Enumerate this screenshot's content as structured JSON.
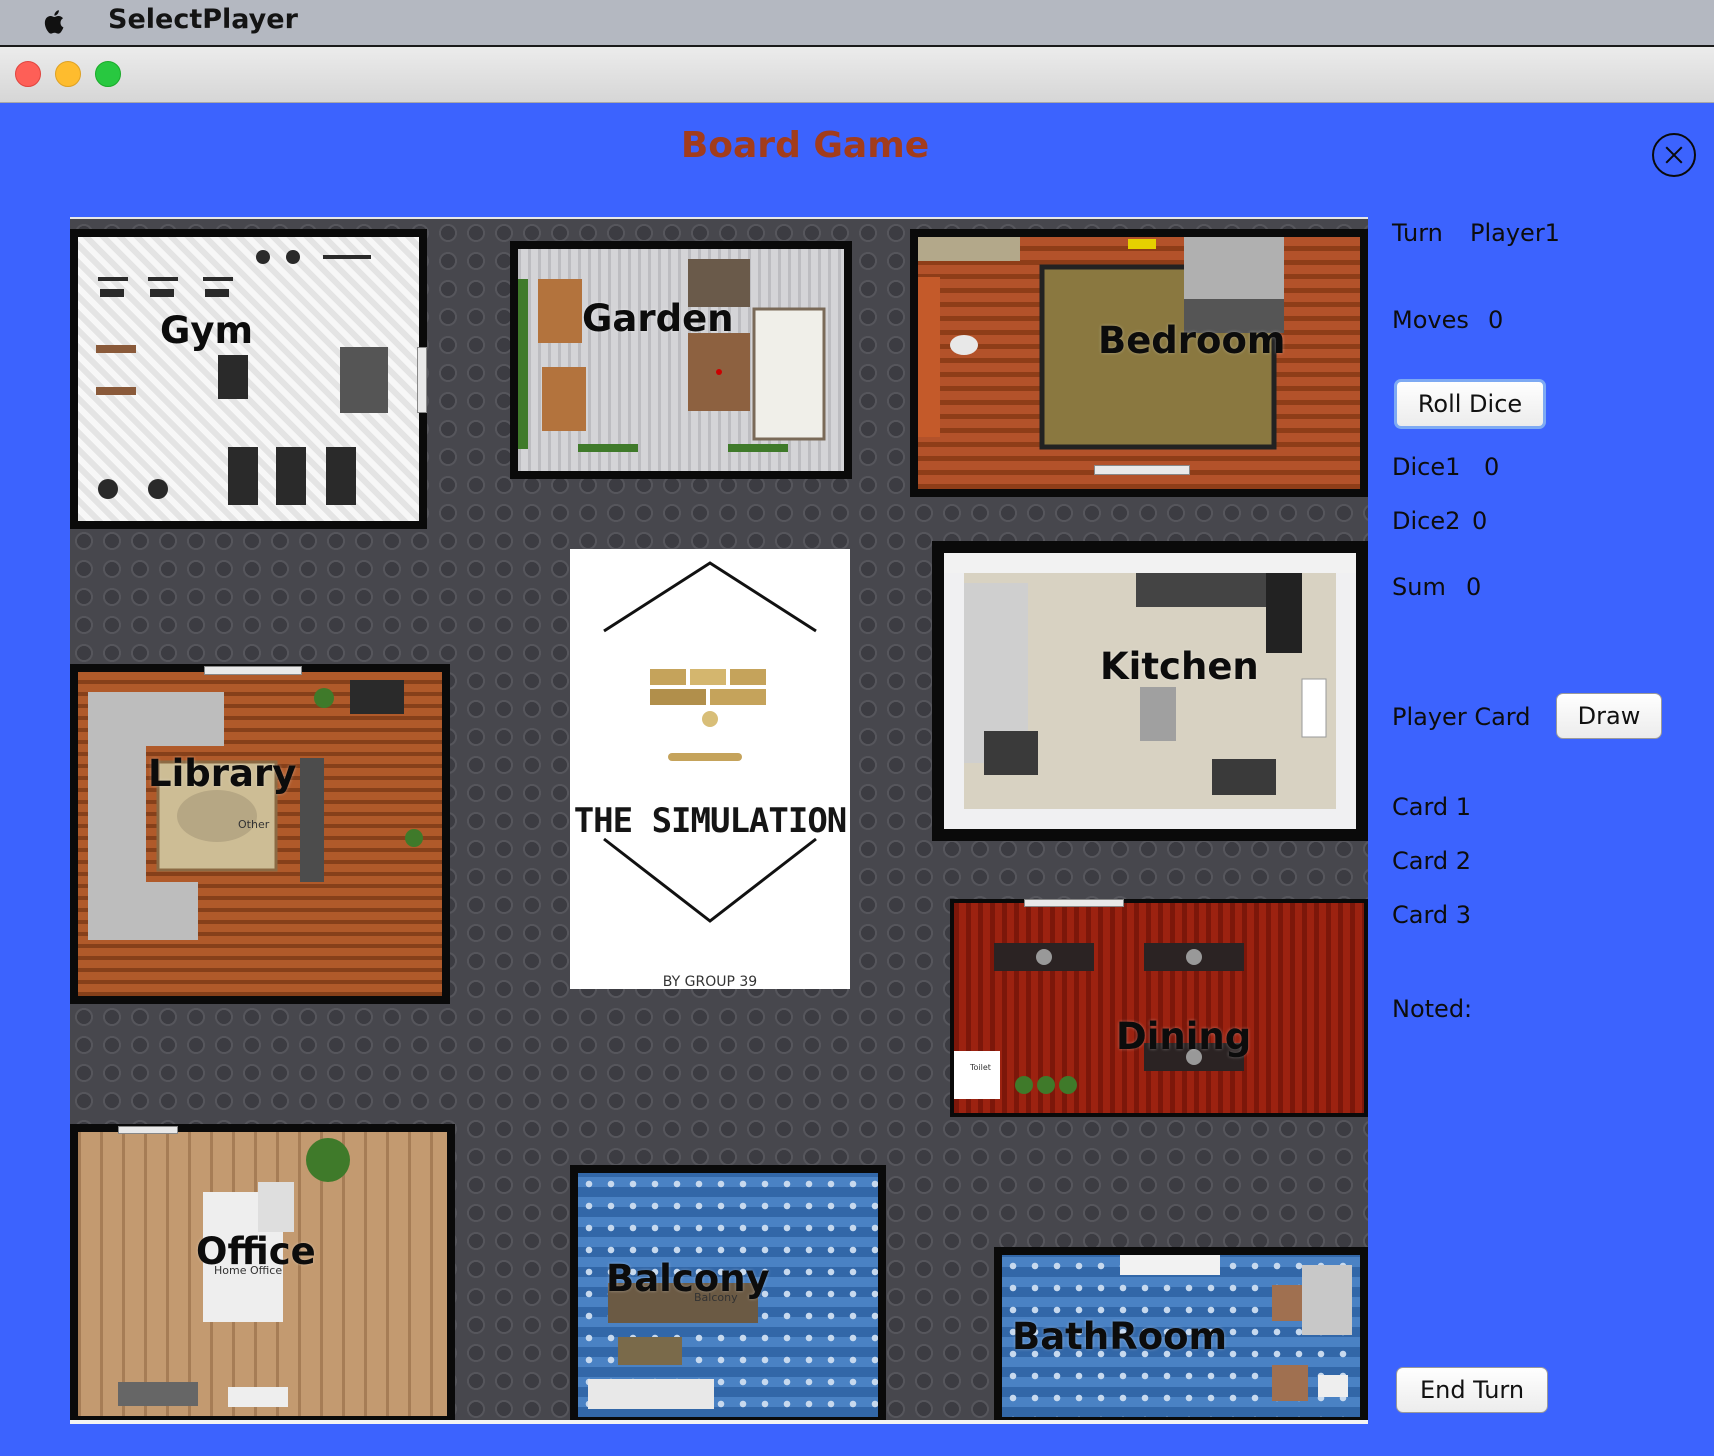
{
  "menubar": {
    "app_name": "SelectPlayer",
    "apple_icon": "apple-logo-icon"
  },
  "window": {
    "buttons": [
      "close",
      "minimize",
      "zoom"
    ]
  },
  "game": {
    "title": "Board Game"
  },
  "board": {
    "rooms": {
      "gym": "Gym",
      "garden": "Garden",
      "bedroom": "Bedroom",
      "kitchen": "Kitchen",
      "library": "Library",
      "dining": "Dining",
      "office": "Office",
      "balcony": "Balcony",
      "bathroom": "BathRoom"
    },
    "room_notes": {
      "library_rug": "Other",
      "office_desk": "Home Office",
      "balcony_sub": "Balcony",
      "dining_tag": "Toilet"
    },
    "logo": {
      "title": "THE SIMULATION",
      "subtitle": "BY GROUP 39"
    }
  },
  "sidebar": {
    "turn_label": "Turn",
    "turn_value": "Player1",
    "moves_label": "Moves",
    "moves_value": "0",
    "roll_dice_label": "Roll Dice",
    "dice1_label": "Dice1",
    "dice1_value": "0",
    "dice2_label": "Dice2",
    "dice2_value": "0",
    "sum_label": "Sum",
    "sum_value": "0",
    "player_card_label": "Player Card",
    "draw_label": "Draw",
    "cards": [
      "Card 1",
      "Card 2",
      "Card 3"
    ],
    "noted_label": "Noted:",
    "end_turn_label": "End Turn"
  },
  "colors": {
    "background": "#3c63fe",
    "title": "#a23c1c"
  }
}
